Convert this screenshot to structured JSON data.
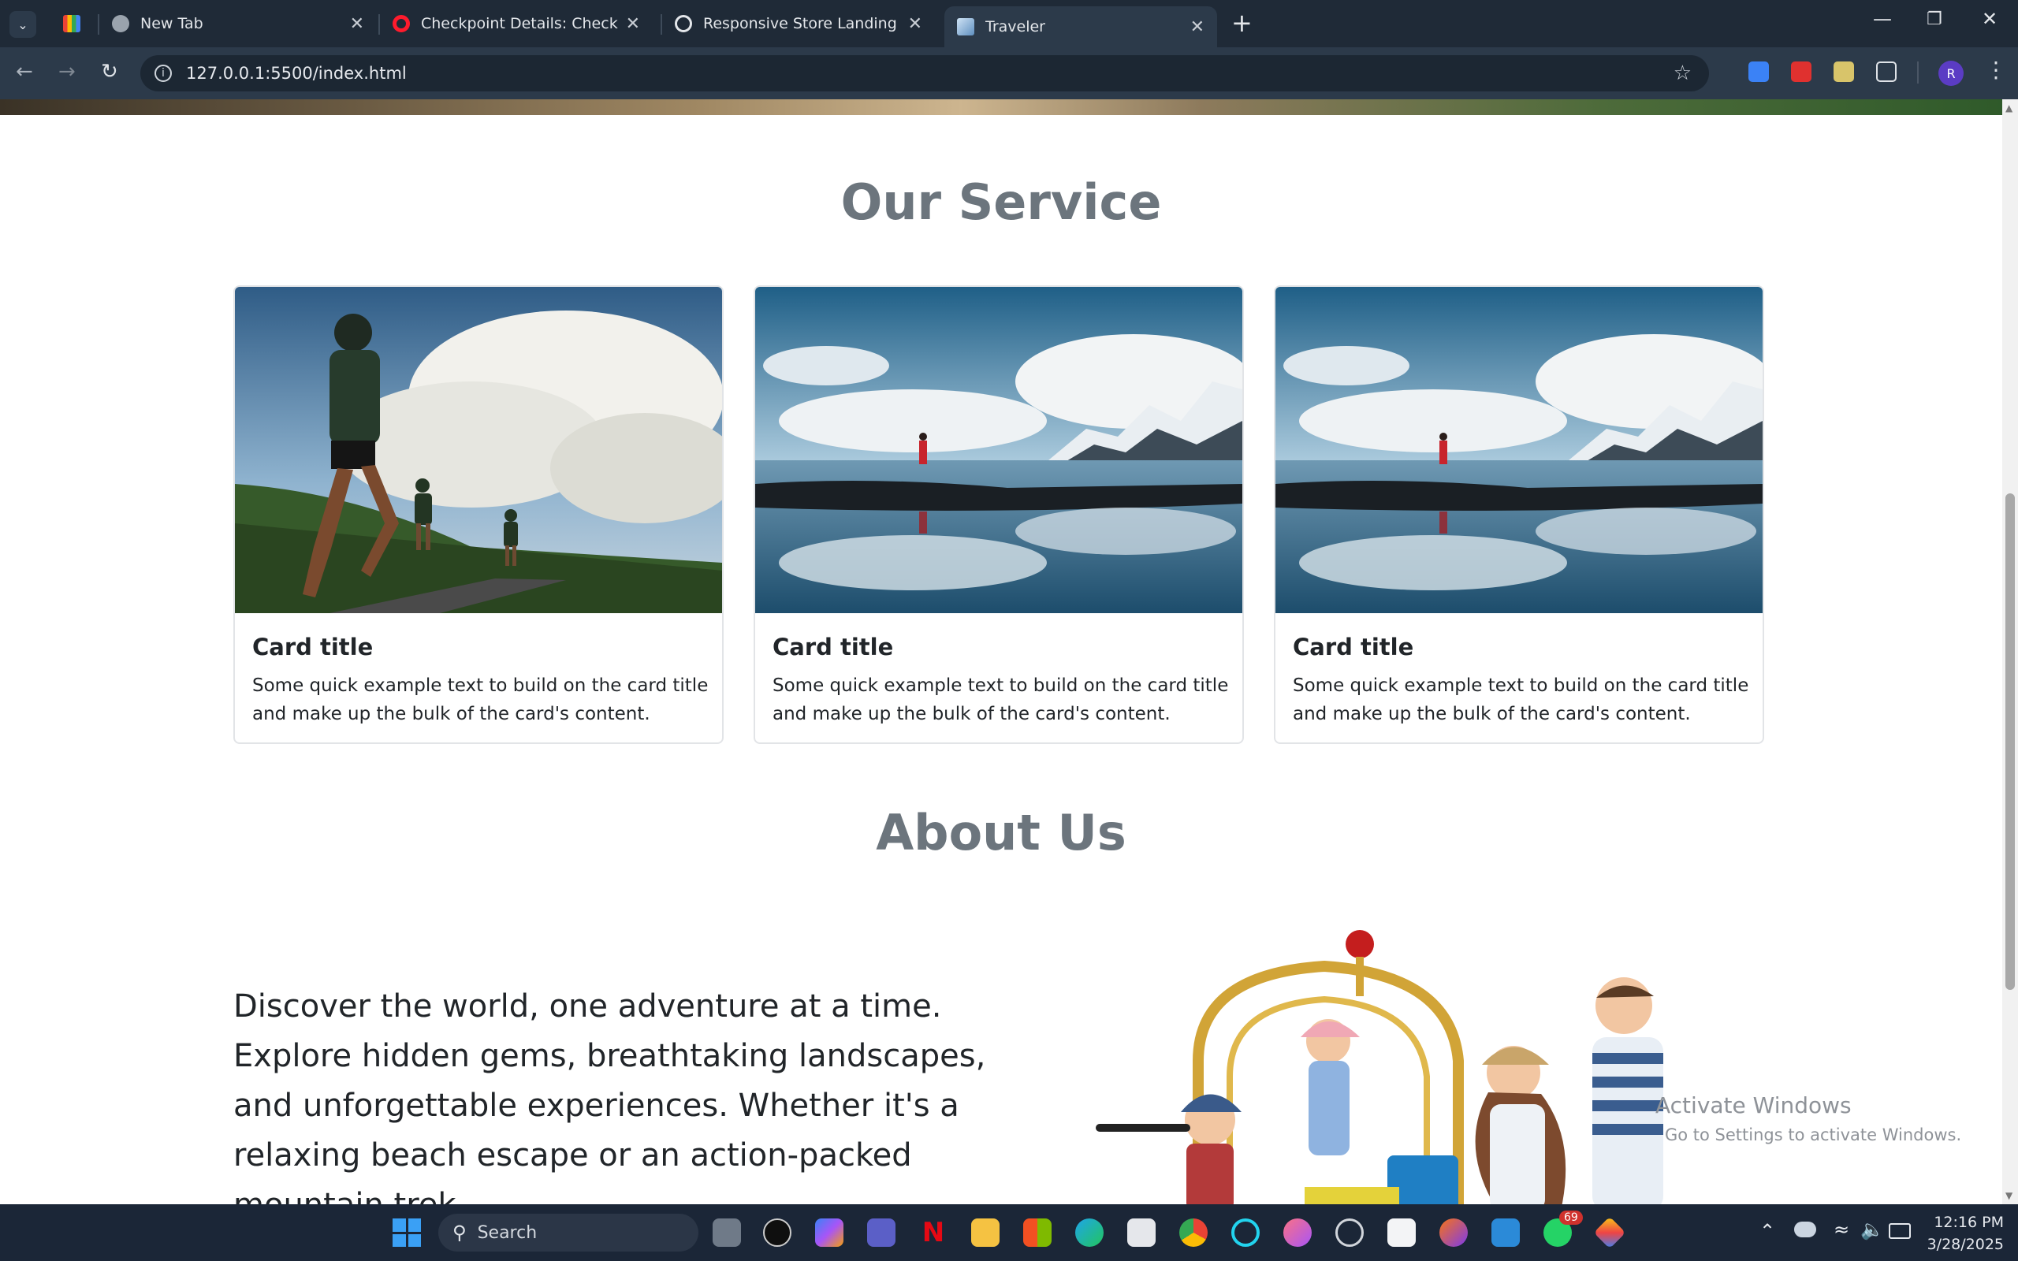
{
  "browser": {
    "tabs": [
      {
        "title": "",
        "icon": "gmail-icon"
      },
      {
        "title": "New Tab",
        "icon": "globe-icon"
      },
      {
        "title": "Checkpoint Details: Checkpoint",
        "icon": "opera-icon"
      },
      {
        "title": "Responsive Store Landing Page",
        "icon": "openai-icon"
      },
      {
        "title": "Traveler",
        "icon": "traveler-icon",
        "active": true
      }
    ],
    "url": "127.0.0.1:5500/index.html",
    "profile_initial": "R"
  },
  "page": {
    "service_title": "Our Service",
    "cards": [
      {
        "title": "Card title",
        "text": "Some quick example text to build on the card title and make up the bulk of the card's content.",
        "image": "runners-photo"
      },
      {
        "title": "Card title",
        "text": "Some quick example text to build on the card title and make up the bulk of the card's content.",
        "image": "mountain-lake-photo"
      },
      {
        "title": "Card title",
        "text": "Some quick example text to build on the card title and make up the bulk of the card's content.",
        "image": "mountain-lake-photo"
      }
    ],
    "about_title": "About Us",
    "about_text": "Discover the world, one adventure at a time. Explore hidden gems, breathtaking landscapes, and unforgettable experiences. Whether it's a relaxing beach escape or an action-packed mountain trek,",
    "about_image": "family-luggage-cart-image"
  },
  "watermark": {
    "line1": "Activate Windows",
    "line2": "Go to Settings to activate Windows."
  },
  "taskbar": {
    "search_label": "Search",
    "whatsapp_badge": "69",
    "time": "12:16 PM",
    "date": "3/28/2025"
  }
}
